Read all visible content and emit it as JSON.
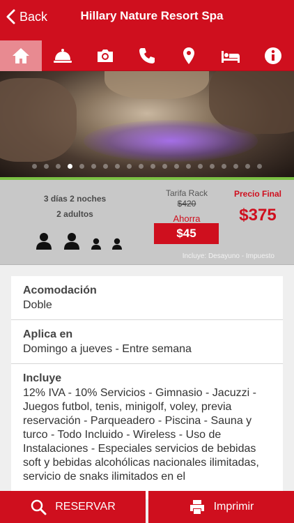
{
  "navbar": {
    "back_label": "Back",
    "title": "Hillary Nature Resort Spa"
  },
  "toolbar": {
    "items": [
      "home-icon",
      "room-service-icon",
      "camera-icon",
      "phone-icon",
      "location-pin-icon",
      "bed-icon",
      "info-icon"
    ],
    "active_index": 0
  },
  "gallery": {
    "slide_count": 20,
    "active_slide": 3
  },
  "package": {
    "nights": "3 días 2 noches",
    "adults": "2 adultos",
    "rack_label": "Tarifa Rack",
    "rack_price": "$420",
    "save_label": "Ahorra",
    "save_amount": "$45",
    "final_label": "Precio Final",
    "final_price": "$375",
    "includes_note": "Incluye: Desayuno - Impuesto"
  },
  "details": {
    "accommodation_title": "Acomodación",
    "accommodation_value": "Doble",
    "applies_title": "Aplica en",
    "applies_value": "Domingo a jueves - Entre semana",
    "includes_title": "Incluye",
    "includes_value": "12% IVA - 10% Servicios - Gimnasio - Jacuzzi - Juegos futbol, tenis, minigolf, voley, previa reservación - Parqueadero - Piscina - Sauna y turco - Todo Incluido - Wireless - Uso de Instalaciones - Especiales servicios de bebidas soft y bebidas alcohólicas nacionales ilimitadas, servicio de snaks ilimitados en el"
  },
  "actions": {
    "reserve_label": "RESERVAR",
    "print_label": "Imprimir"
  },
  "colors": {
    "brand_red": "#cf0f1e",
    "accent_green": "#7bc043",
    "panel_gray": "#c8c8c8"
  }
}
